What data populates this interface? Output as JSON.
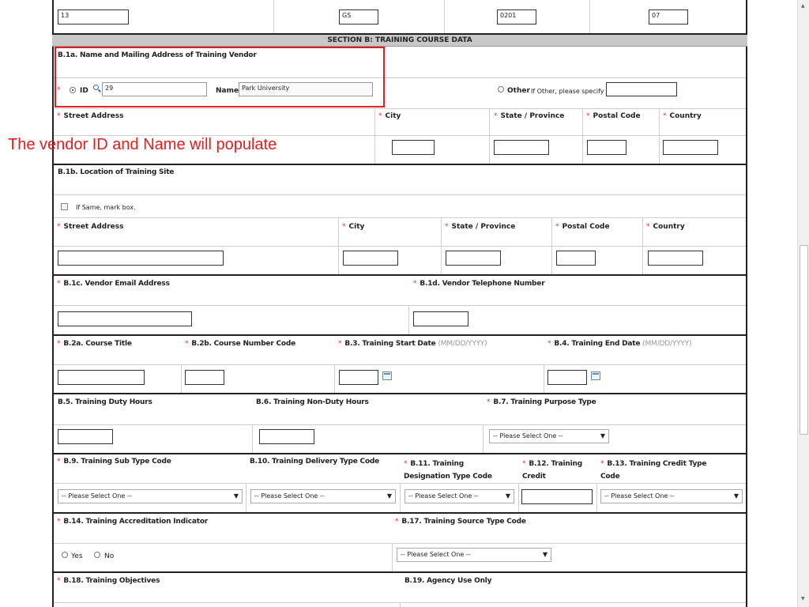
{
  "top_row": {
    "v1": "13",
    "v2": "GS",
    "v3": "0201",
    "v4": "07"
  },
  "section_b_title": "SECTION B: TRAINING COURSE DATA",
  "b1a": {
    "label": "B.1a. Name and Mailing Address of Training Vendor",
    "id_label": "ID",
    "id_value": "29",
    "name_label": "Name",
    "name_value": "Park University",
    "other_label": "Other",
    "other_hint": "If Other, please specify"
  },
  "vendor_addr": {
    "street": "Street Address",
    "city": "City",
    "state": "State / Province",
    "postal": "Postal Code",
    "country": "Country"
  },
  "annotation": "The vendor ID and Name will populate",
  "b1b": {
    "label": "B.1b. Location of Training Site",
    "same_label": "If Same, mark box.",
    "street": "Street Address",
    "city": "City",
    "state": "State / Province",
    "postal": "Postal Code",
    "country": "Country"
  },
  "b1c": "B.1c. Vendor Email Address",
  "b1d": "B.1d. Vendor Telephone Number",
  "b2a": "B.2a. Course Title",
  "b2b": "B.2b. Course Number Code",
  "b3": "B.3. Training Start Date",
  "b4": "B.4. Training End Date",
  "date_hint": "(MM/DD/YYYY)",
  "b5": "B.5. Training Duty Hours",
  "b6": "B.6. Training Non-Duty Hours",
  "b7": "B.7. Training Purpose Type",
  "select_default": "-- Please Select One --",
  "b9": "B.9. Training Sub Type Code",
  "b10": "B.10. Training Delivery Type Code",
  "b11a": "B.11. Training",
  "b11b": "Designation Type Code",
  "b12a": "B.12.  Training",
  "b12b": "Credit",
  "b13a": "B.13. Training Credit Type",
  "b13b": "Code",
  "b14": "B.14.  Training Accreditation Indicator",
  "yes": "Yes",
  "no": "No",
  "b17": "B.17. Training Source Type Code",
  "b18": "B.18. Training Objectives",
  "b19": "B.19. Agency Use Only",
  "star": "*"
}
